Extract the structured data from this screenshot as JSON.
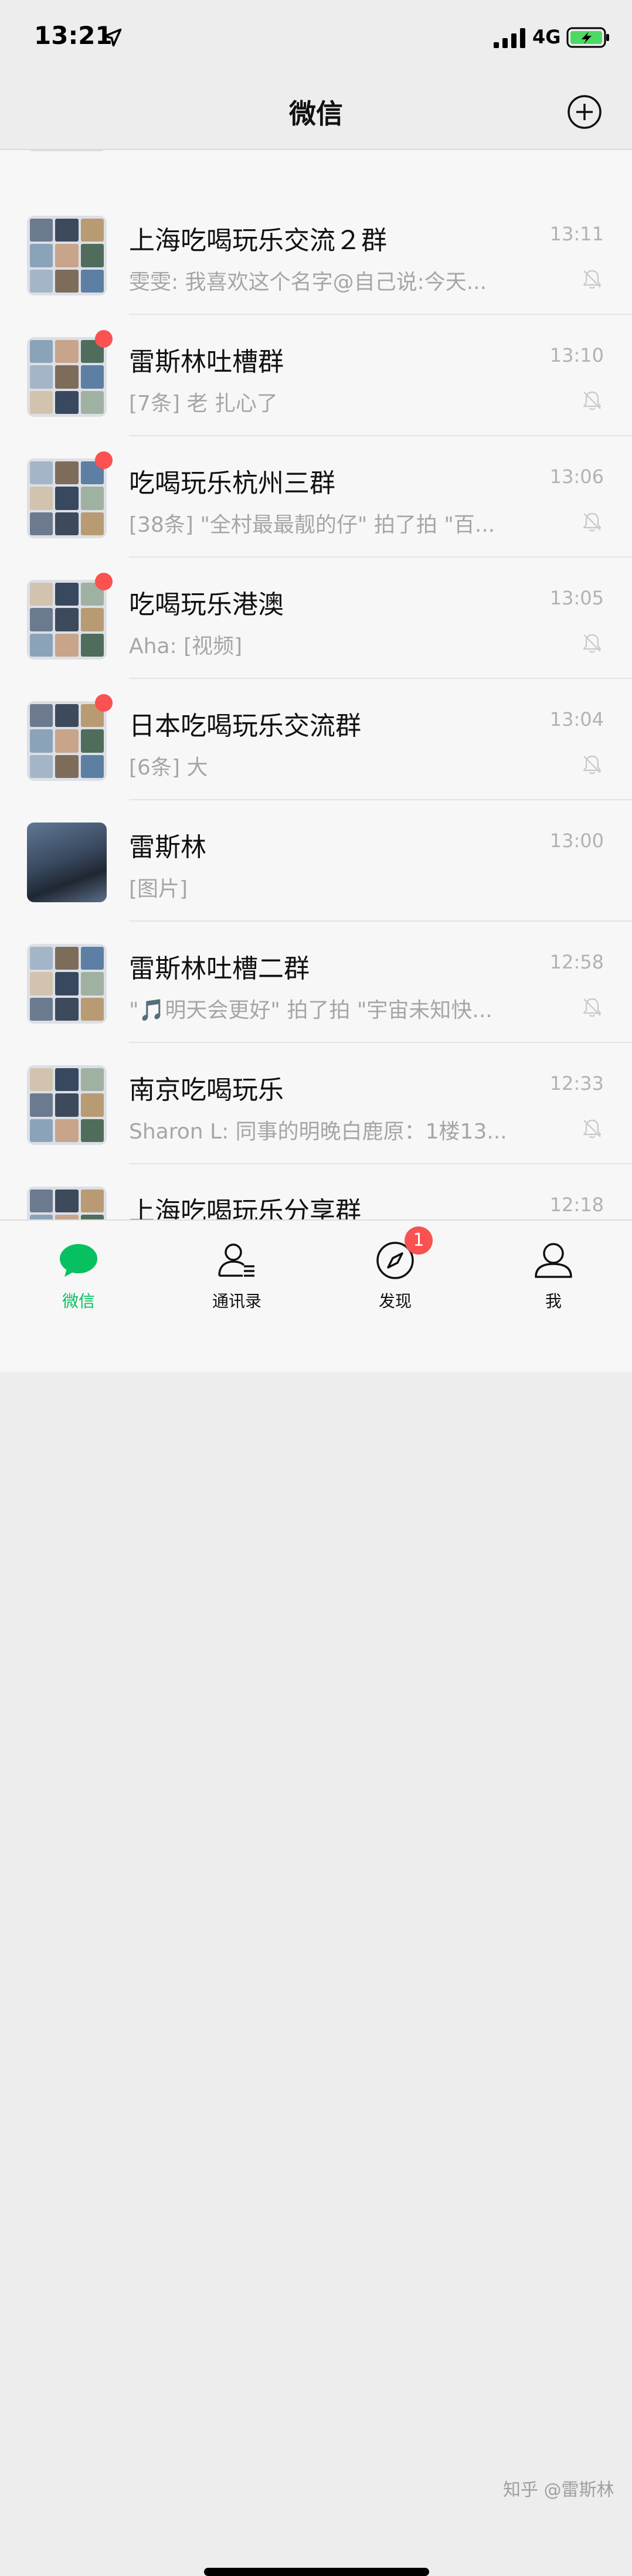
{
  "status_bar": {
    "time": "13:21",
    "network": "4G"
  },
  "nav": {
    "title": "微信"
  },
  "chats": [
    {
      "title": "上海吃喝玩乐交流２群",
      "time": "13:11",
      "preview": "雯雯: 我喜欢这个名字@自己说:今天...",
      "unread_dot": false,
      "muted": true,
      "avatar_kind": "grid"
    },
    {
      "title": "雷斯林吐槽群",
      "time": "13:10",
      "preview": "[7条] 老 扎心了",
      "unread_dot": true,
      "muted": true,
      "avatar_kind": "grid"
    },
    {
      "title": "吃喝玩乐杭州三群",
      "time": "13:06",
      "preview": "[38条] \"全村最最靓的仔\" 拍了拍 \"百...",
      "unread_dot": true,
      "muted": true,
      "avatar_kind": "grid"
    },
    {
      "title": "吃喝玩乐港澳",
      "time": "13:05",
      "preview": "Aha: [视频]",
      "unread_dot": true,
      "muted": true,
      "avatar_kind": "grid"
    },
    {
      "title": "日本吃喝玩乐交流群",
      "time": "13:04",
      "preview": "[6条] 大",
      "unread_dot": true,
      "muted": true,
      "avatar_kind": "grid"
    },
    {
      "title": "雷斯林",
      "time": "13:00",
      "preview": "[图片]",
      "unread_dot": false,
      "muted": false,
      "avatar_kind": "photo"
    },
    {
      "title": "雷斯林吐槽二群",
      "time": "12:58",
      "preview": "\"🎵明天会更好\" 拍了拍 \"宇宙未知快...",
      "unread_dot": false,
      "muted": true,
      "avatar_kind": "grid"
    },
    {
      "title": "南京吃喝玩乐",
      "time": "12:33",
      "preview": "Sharon L: 同事的明晚白鹿原：1楼13...",
      "unread_dot": false,
      "muted": true,
      "avatar_kind": "grid"
    },
    {
      "title": "上海吃喝玩乐分享群",
      "time": "12:18",
      "preview": "",
      "unread_dot": false,
      "muted": true,
      "avatar_kind": "grid"
    }
  ],
  "tabs": [
    {
      "label": "微信",
      "icon": "chat-bubble-icon",
      "active": true
    },
    {
      "label": "通讯录",
      "icon": "contacts-icon",
      "active": false
    },
    {
      "label": "发现",
      "icon": "compass-icon",
      "active": false,
      "badge": "1"
    },
    {
      "label": "我",
      "icon": "person-icon",
      "active": false
    }
  ],
  "watermark": "知乎 @雷斯林",
  "colors": {
    "accent_green": "#07c160",
    "badge_red": "#fa5151",
    "background": "#ededed"
  }
}
